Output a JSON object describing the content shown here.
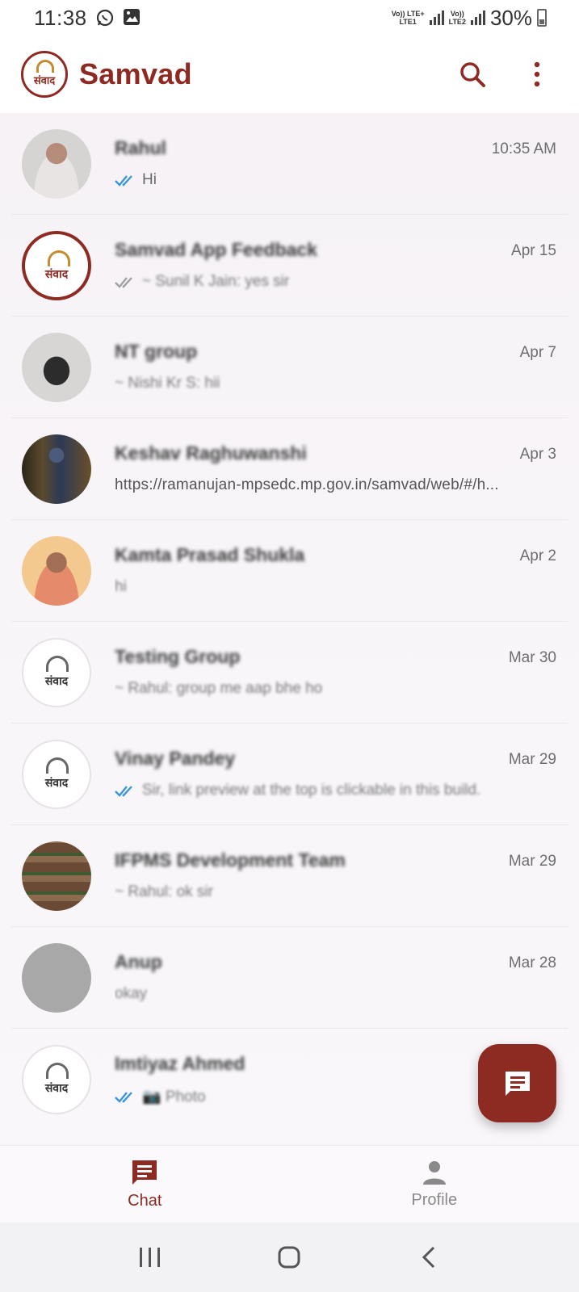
{
  "status_bar": {
    "time": "11:38",
    "net1_top": "Vo)) LTE+",
    "net1_bottom": "LTE1",
    "net2_top": "Vo))",
    "net2_bottom": "LTE2",
    "battery": "30%"
  },
  "app_bar": {
    "logo_text": "संवाद",
    "title": "Samvad"
  },
  "chats": [
    {
      "name": "Rahul",
      "time": "10:35 AM",
      "preview": "Hi",
      "ticks": "blue",
      "avatar": "person"
    },
    {
      "name": "Samvad App Feedback",
      "time": "Apr 15",
      "preview": "~ Sunil K Jain: yes sir",
      "ticks": "grey",
      "avatar": "logo-red"
    },
    {
      "name": "NT group",
      "time": "Apr 7",
      "preview": "~ Nishi Kr S: hii",
      "ticks": "",
      "avatar": "mouse"
    },
    {
      "name": "Keshav Raghuwanshi",
      "time": "Apr 3",
      "preview": "https://ramanujan-mpsedc.mp.gov.in/samvad/web/#/h...",
      "ticks": "",
      "avatar": "dark"
    },
    {
      "name": "Kamta Prasad Shukla",
      "time": "Apr 2",
      "preview": "hi",
      "ticks": "",
      "avatar": "person2"
    },
    {
      "name": "Testing Group",
      "time": "Mar 30",
      "preview": "~ Rahul: group me aap bhe ho",
      "ticks": "",
      "avatar": "logo"
    },
    {
      "name": "Vinay Pandey",
      "time": "Mar 29",
      "preview": "Sir, link preview at the top is clickable in this build.",
      "ticks": "blue",
      "avatar": "logo"
    },
    {
      "name": "IFPMS Development Team",
      "time": "Mar 29",
      "preview": "~ Rahul: ok sir",
      "ticks": "",
      "avatar": "wood"
    },
    {
      "name": "Anup",
      "time": "Mar 28",
      "preview": "okay",
      "ticks": "",
      "avatar": "grey"
    },
    {
      "name": "Imtiyaz Ahmed",
      "time": "",
      "preview": "📷 Photo",
      "ticks": "blue",
      "avatar": "logo"
    }
  ],
  "bottom_nav": {
    "chat_label": "Chat",
    "profile_label": "Profile"
  },
  "colors": {
    "brand": "#8d2a22",
    "tick_blue": "#3a97d4",
    "tick_grey": "#a0a0a0"
  }
}
